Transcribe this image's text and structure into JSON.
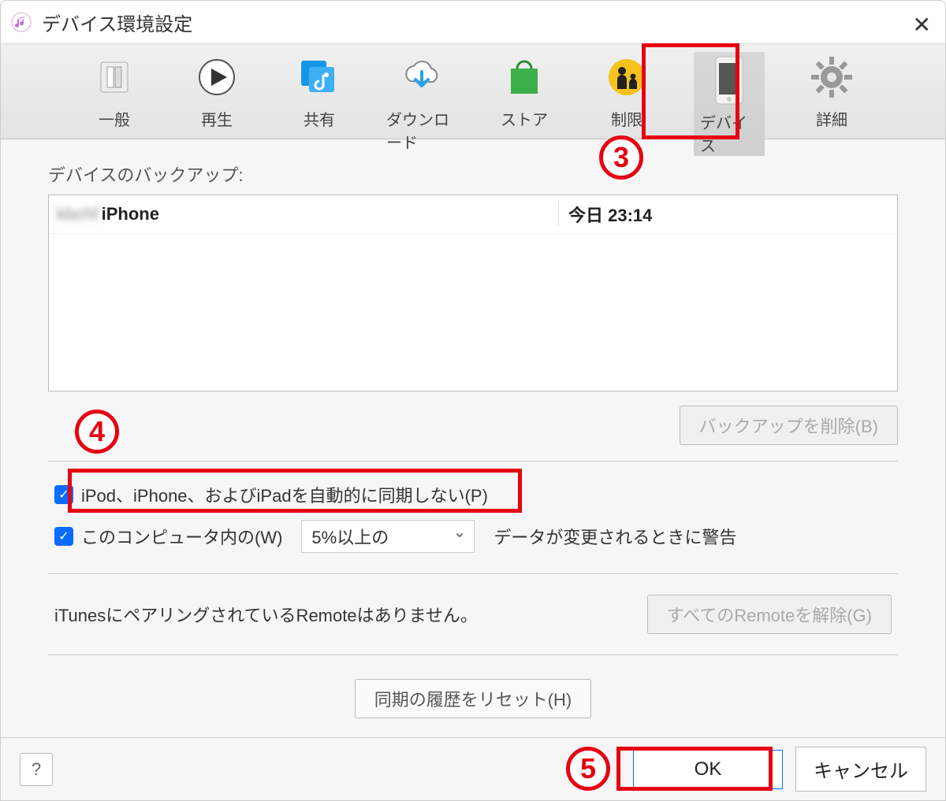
{
  "window": {
    "title": "デバイス環境設定"
  },
  "toolbar": {
    "items": [
      {
        "label": "一般"
      },
      {
        "label": "再生"
      },
      {
        "label": "共有"
      },
      {
        "label": "ダウンロード"
      },
      {
        "label": "ストア"
      },
      {
        "label": "制限"
      },
      {
        "label": "デバイス"
      },
      {
        "label": "詳細"
      }
    ]
  },
  "backups": {
    "heading": "デバイスのバックアップ:",
    "rows": [
      {
        "name_hidden": "kbchf",
        "name": "iPhone",
        "date": "今日 23:14"
      }
    ],
    "delete_label": "バックアップを削除(B)"
  },
  "options": {
    "no_auto_sync": "iPod、iPhone、およびiPadを自動的に同期しない(P)",
    "warn_prefix": "このコンピュータ内の(W)",
    "warn_select": "5%以上の",
    "warn_suffix": "データが変更されるときに警告"
  },
  "remote": {
    "status": "iTunesにペアリングされているRemoteはありません。",
    "unpair_label": "すべてのRemoteを解除(G)"
  },
  "reset": {
    "label": "同期の履歴をリセット(H)"
  },
  "footer": {
    "help": "?",
    "ok": "OK",
    "cancel": "キャンセル"
  },
  "annotations": {
    "n3": "3",
    "n4": "4",
    "n5": "5"
  }
}
